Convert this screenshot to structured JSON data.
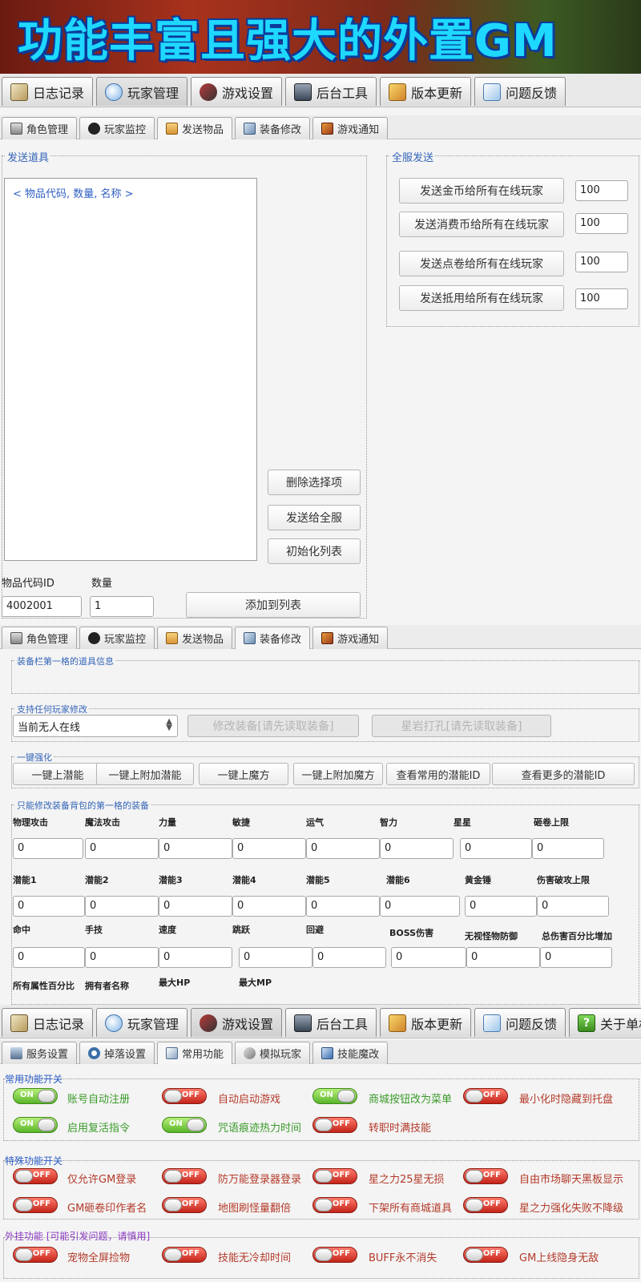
{
  "banner": {
    "title": "功能丰富且强大的外置GM"
  },
  "main_tabs_1": [
    {
      "label": "日志记录",
      "icon": "log-icon"
    },
    {
      "label": "玩家管理",
      "icon": "player-icon"
    },
    {
      "label": "游戏设置",
      "icon": "game-icon"
    },
    {
      "label": "后台工具",
      "icon": "tools-icon"
    },
    {
      "label": "版本更新",
      "icon": "update-icon"
    },
    {
      "label": "问题反馈",
      "icon": "feedback-icon"
    }
  ],
  "sub_tabs_1": [
    {
      "label": "角色管理"
    },
    {
      "label": "玩家监控"
    },
    {
      "label": "发送物品"
    },
    {
      "label": "装备修改"
    },
    {
      "label": "游戏通知"
    }
  ],
  "send_items": {
    "group_label": "发送道具",
    "list_header": "< 物品代码, 数量, 名称 >",
    "delete_button": "删除选择项",
    "send_all_button": "发送给全服",
    "init_button": "初始化列表",
    "item_id_label": "物品代码ID",
    "quantity_label": "数量",
    "item_id_value": "4002001",
    "quantity_value": "1",
    "add_button": "添加到列表"
  },
  "server_send": {
    "group_label": "全服发送",
    "rows": [
      {
        "button": "发送金币给所有在线玩家",
        "value": "100"
      },
      {
        "button": "发送消费币给所有在线玩家",
        "value": "100"
      },
      {
        "button": "发送点卷给所有在线玩家",
        "value": "100"
      },
      {
        "button": "发送抵用给所有在线玩家",
        "value": "100"
      }
    ]
  },
  "sub_tabs_2": [
    {
      "label": "角色管理"
    },
    {
      "label": "玩家监控"
    },
    {
      "label": "发送物品"
    },
    {
      "label": "装备修改"
    },
    {
      "label": "游戏通知"
    }
  ],
  "equip": {
    "slot_info_label": "装备栏第一格的道具信息",
    "modify_label": "支持任何玩家修改",
    "player_select": "当前无人在线",
    "modify_button": "修改装备[请先读取装备]",
    "star_button": "星岩打孔[请先读取装备]",
    "one_key_label": "一键强化",
    "one_key_buttons": [
      "一键上潜能",
      "一键上附加潜能",
      "一键上魔方",
      "一键上附加魔方",
      "查看常用的潜能ID",
      "查看更多的潜能ID"
    ],
    "bag_label": "只能修改装备背包的第一格的装备",
    "row1_labels": [
      "物理攻击",
      "魔法攻击",
      "力量",
      "敏捷",
      "运气",
      "智力",
      "星星",
      "砸卷上限"
    ],
    "row1_values": [
      "0",
      "0",
      "0",
      "0",
      "0",
      "0",
      "0",
      "0"
    ],
    "row2_labels": [
      "潜能1",
      "潜能2",
      "潜能3",
      "潜能4",
      "潜能5",
      "潜能6",
      "黄金锤",
      "伤害破攻上限"
    ],
    "row2_values": [
      "0",
      "0",
      "0",
      "0",
      "0",
      "0",
      "0",
      "0"
    ],
    "row3_labels": [
      "命中",
      "手技",
      "速度",
      "跳跃",
      "回避",
      "BOSS伤害",
      "无视怪物防御",
      "总伤害百分比增加"
    ],
    "row3_values": [
      "0",
      "0",
      "0",
      "0",
      "0",
      "0",
      "0",
      "0"
    ],
    "row4_labels": [
      "所有属性百分比",
      "拥有者名称",
      "最大HP",
      "最大MP"
    ]
  },
  "main_tabs_2": [
    {
      "label": "日志记录"
    },
    {
      "label": "玩家管理"
    },
    {
      "label": "游戏设置"
    },
    {
      "label": "后台工具"
    },
    {
      "label": "版本更新"
    },
    {
      "label": "问题反馈"
    },
    {
      "label": "关于单机"
    }
  ],
  "sub_tabs_3": [
    {
      "label": "服务设置"
    },
    {
      "label": "掉落设置"
    },
    {
      "label": "常用功能"
    },
    {
      "label": "模拟玩家"
    },
    {
      "label": "技能魔改"
    }
  ],
  "switch_text": {
    "on": "ON",
    "off": "OFF"
  },
  "common_functions": {
    "title": "常用功能开关",
    "switches": [
      {
        "label": "账号自动注册",
        "state": "on"
      },
      {
        "label": "自动启动游戏",
        "state": "off"
      },
      {
        "label": "商城按钮改为菜单",
        "state": "on"
      },
      {
        "label": "最小化时隐藏到托盘",
        "state": "off"
      },
      {
        "label": "启用复活指令",
        "state": "on"
      },
      {
        "label": "咒语痕迹热力时间",
        "state": "on"
      },
      {
        "label": "转职时满技能",
        "state": "off"
      }
    ]
  },
  "special_functions": {
    "title": "特殊功能开关",
    "switches": [
      {
        "label": "仅允许GM登录",
        "state": "off"
      },
      {
        "label": "防万能登录器登录",
        "state": "off"
      },
      {
        "label": "星之力25星无损",
        "state": "off"
      },
      {
        "label": "自由市场聊天黑板显示",
        "state": "off"
      },
      {
        "label": "GM砸卷印作者名",
        "state": "off"
      },
      {
        "label": "地图刷怪量翻倍",
        "state": "off"
      },
      {
        "label": "下架所有商城道具",
        "state": "off"
      },
      {
        "label": "星之力强化失败不降级",
        "state": "off"
      }
    ]
  },
  "plugin_functions": {
    "title": "外挂功能 [可能引发问题，请慎用]",
    "switches": [
      {
        "label": "宠物全屏捡物",
        "state": "off"
      },
      {
        "label": "技能无冷却时间",
        "state": "off"
      },
      {
        "label": "BUFF永不消失",
        "state": "off"
      },
      {
        "label": "GM上线隐身无敌",
        "state": "off"
      }
    ]
  },
  "colors": {
    "accent": "#3465b8",
    "on": "#5ab52a",
    "off": "#c3241a",
    "banner_text": "#1fd8ff"
  }
}
